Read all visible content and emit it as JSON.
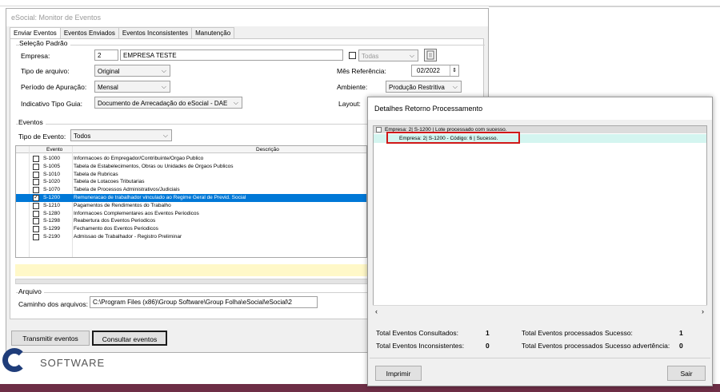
{
  "main": {
    "title": "eSocial: Monitor de Eventos",
    "tabs": [
      "Enviar Eventos",
      "Eventos Enviados",
      "Eventos Inconsistentes",
      "Manutenção"
    ],
    "selecao": {
      "group": "Seleção Padrão",
      "empresa_label": "Empresa:",
      "empresa_code": "2",
      "empresa_name": "EMPRESA TESTE",
      "todas_label": "Todas",
      "tipo_arquivo_label": "Tipo de arquivo:",
      "tipo_arquivo": "Original",
      "periodo_label": "Período de Apuração:",
      "periodo": "Mensal",
      "indicativo_label": "Indicativo Tipo Guia:",
      "indicativo": "Documento de Arrecadação do eSocial - DAE",
      "mes_label": "Mês Referência:",
      "mes": "02/2022",
      "ambiente_label": "Ambiente:",
      "ambiente": "Produção Restritiva",
      "layout_label": "Layout:"
    },
    "eventos": {
      "group": "Eventos",
      "tipo_label": "Tipo de Evento:",
      "tipo": "Todos",
      "col_evento": "Evento",
      "col_descricao": "Descrição",
      "rows": [
        {
          "code": "S-1000",
          "desc": "Informacoes do Empregador/Contribuinte/Orgao Publico",
          "checked": false
        },
        {
          "code": "S-1005",
          "desc": "Tabela de Estabelecimentos, Obras ou Unidades de Orgaos Publicos",
          "checked": false
        },
        {
          "code": "S-1010",
          "desc": "Tabela de Rubricas",
          "checked": false
        },
        {
          "code": "S-1020",
          "desc": "Tabela de Lotacoes Tributarias",
          "checked": false
        },
        {
          "code": "S-1070",
          "desc": "Tabela de Processos Administrativos/Judiciais",
          "checked": false
        },
        {
          "code": "S-1200",
          "desc": "Remuneracao de trabalhador vinculado ao Regime Geral de Previd. Social",
          "checked": true
        },
        {
          "code": "S-1210",
          "desc": "Pagamentos de Rendimentos do Trabalho",
          "checked": false
        },
        {
          "code": "S-1280",
          "desc": "Informacoes Complementares aos Eventos Periodicos",
          "checked": false
        },
        {
          "code": "S-1298",
          "desc": "Reabertura dos Eventos Periodicos",
          "checked": false
        },
        {
          "code": "S-1299",
          "desc": "Fechamento dos Eventos Periodicos",
          "checked": false
        },
        {
          "code": "S-2190",
          "desc": "Admissao de Trabalhador - Registro Preliminar",
          "checked": false
        }
      ]
    },
    "arquivo": {
      "group": "Arquivo",
      "caminho_label": "Caminho dos arquivos:",
      "caminho": "C:\\Program Files (x86)\\Group Software\\Group Folha\\eSocial\\eSocial\\2"
    },
    "buttons": {
      "transmitir": "Transmitir eventos",
      "consultar": "Consultar eventos"
    },
    "brand": "SOFTWARE"
  },
  "dialog": {
    "title": "Detalhes Retorno Processamento",
    "tree_parent": "Empresa: 2| S-1200 | Lote processado com sucesso.",
    "tree_child": "Empresa: 2| S-1200 -  Código: 6 | Sucesso.",
    "summary": {
      "consultados_label": "Total Eventos Consultados:",
      "consultados": "1",
      "inconsistentes_label": "Total Eventos Inconsistentes:",
      "inconsistentes": "0",
      "sucesso_label": "Total Eventos processados Sucesso:",
      "sucesso": "1",
      "advertencia_label": "Total Eventos processados Sucesso advertência:",
      "advertencia": "0"
    },
    "buttons": {
      "imprimir": "Imprimir",
      "sair": "Sair"
    }
  },
  "icons": {
    "calendar": "calendar-icon",
    "spinner": "spinner-icon",
    "dropdown": "chevron-down-icon"
  }
}
